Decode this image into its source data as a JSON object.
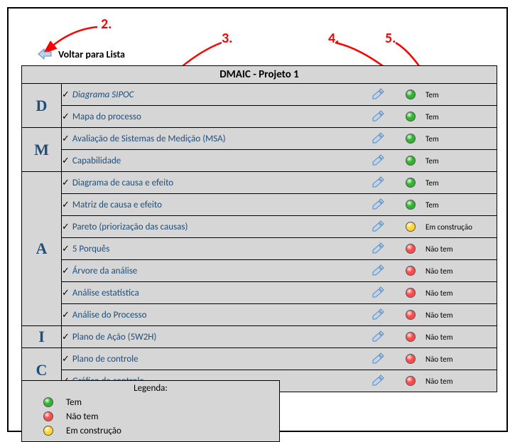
{
  "annotations": {
    "n2": "2.",
    "n3": "3.",
    "n4": "4.",
    "n5": "5."
  },
  "back_label": "Voltar para Lista",
  "title": "DMAIC - Projeto 1",
  "status_colors": {
    "tem": "#2fb52f",
    "nao": "#ff4b4b",
    "constr": "#ffd633"
  },
  "phases": [
    {
      "letter": "D",
      "tools": [
        {
          "name": "Diagrama SIPOC",
          "status": "tem",
          "status_label": "Tem",
          "current": true
        },
        {
          "name": "Mapa do processo",
          "status": "tem",
          "status_label": "Tem"
        }
      ]
    },
    {
      "letter": "M",
      "tools": [
        {
          "name": "Avaliação de Sistemas de Medição (MSA)",
          "status": "tem",
          "status_label": "Tem"
        },
        {
          "name": "Capabilidade",
          "status": "tem",
          "status_label": "Tem"
        }
      ]
    },
    {
      "letter": "A",
      "tools": [
        {
          "name": "Diagrama de causa e efeito",
          "status": "tem",
          "status_label": "Tem"
        },
        {
          "name": "Matriz de causa e efeito",
          "status": "tem",
          "status_label": "Tem"
        },
        {
          "name": "Pareto (priorização das causas)",
          "status": "constr",
          "status_label": "Em construção"
        },
        {
          "name": " 5 Porquês",
          "status": "nao",
          "status_label": "Não tem"
        },
        {
          "name": "Árvore da análise",
          "status": "nao",
          "status_label": "Não tem"
        },
        {
          "name": "Análise estatística",
          "status": "nao",
          "status_label": "Não tem"
        },
        {
          "name": "Análise do Processo",
          "status": "nao",
          "status_label": "Não tem"
        }
      ]
    },
    {
      "letter": "I",
      "tools": [
        {
          "name": "Plano de Ação (5W2H)",
          "status": "nao",
          "status_label": "Não tem"
        }
      ]
    },
    {
      "letter": "C",
      "tools": [
        {
          "name": "Plano de controle",
          "status": "nao",
          "status_label": "Não tem"
        },
        {
          "name": "Gráfico de controle",
          "status": "nao",
          "status_label": "Não tem"
        }
      ]
    }
  ],
  "legend": {
    "title": "Legenda:",
    "items": [
      {
        "status": "tem",
        "label": "Tem"
      },
      {
        "status": "nao",
        "label": "Não tem"
      },
      {
        "status": "constr",
        "label": "Em construção"
      }
    ]
  }
}
